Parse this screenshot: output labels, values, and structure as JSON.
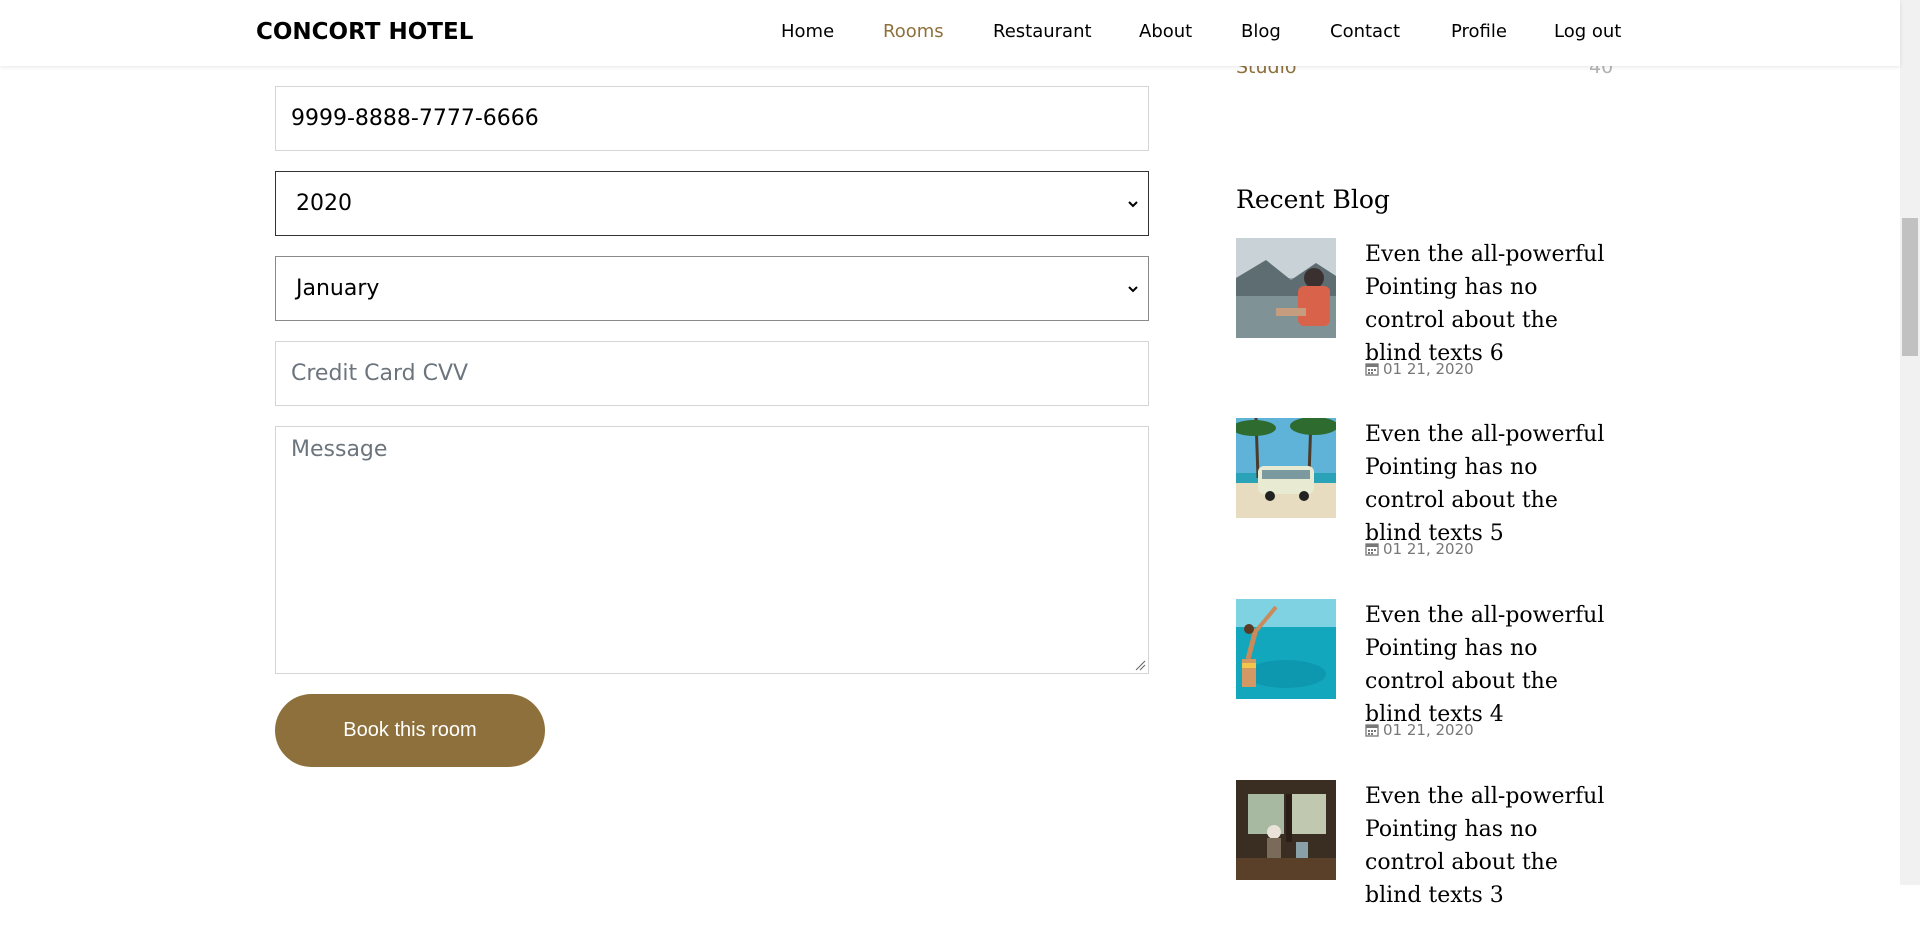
{
  "header": {
    "brand": "CONCORT HOTEL",
    "nav": [
      "Home",
      "Rooms",
      "Restaurant",
      "About",
      "Blog",
      "Contact",
      "Profile",
      "Log out"
    ],
    "active_nav": "Rooms"
  },
  "form": {
    "card_number_value": "9999-8888-7777-6666",
    "year_selected": "2020",
    "month_selected": "January",
    "cvv_placeholder": "Credit Card CVV",
    "message_placeholder": "Message",
    "submit_label": "Book this room"
  },
  "sidebar": {
    "category": {
      "label": "Studio",
      "count": "40"
    },
    "recent_blog_title": "Recent Blog",
    "posts": [
      {
        "title": "Even the all-powerful Pointing has no control about the blind texts 6",
        "date": "01 21, 2020",
        "thumb": "hiker-lake-photo"
      },
      {
        "title": "Even the all-powerful Pointing has no control about the blind texts 5",
        "date": "01 21, 2020",
        "thumb": "van-beach-photo"
      },
      {
        "title": "Even the all-powerful Pointing has no control about the blind texts 4",
        "date": "01 21, 2020",
        "thumb": "sea-swimmer-photo"
      },
      {
        "title": "Even the all-powerful Pointing has no control about the blind texts 3",
        "date": "01 21, 2020",
        "thumb": "cafe-interior-photo"
      }
    ]
  },
  "colors": {
    "accent": "#8d703b",
    "muted": "#777777",
    "border": "#d5d5d5"
  },
  "icons": {
    "select_arrow": "chevron-down-icon",
    "date": "calendar-icon",
    "textarea_resize": "resize-handle-icon"
  }
}
